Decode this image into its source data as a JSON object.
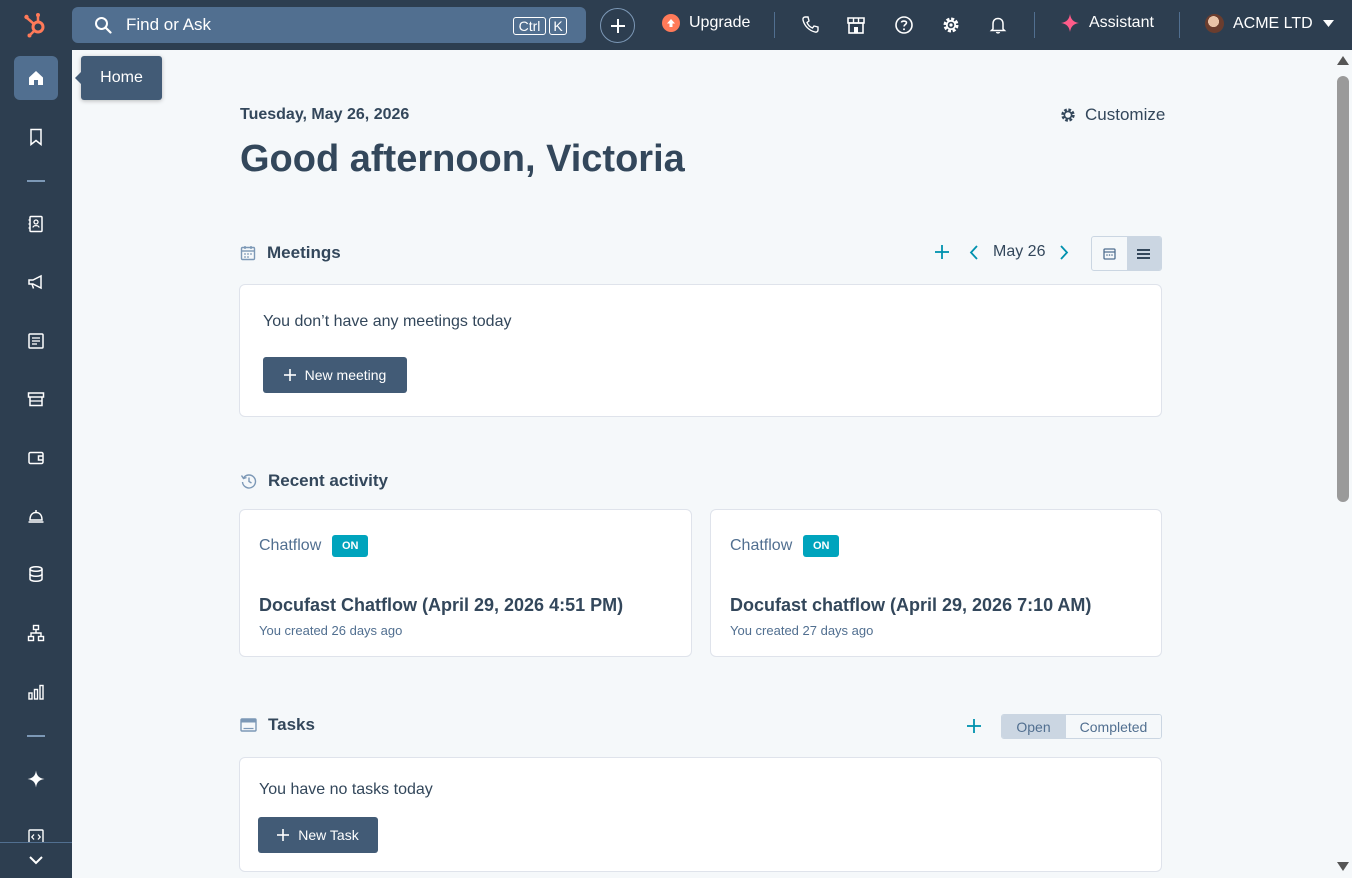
{
  "search": {
    "placeholder": "Find or Ask",
    "shortcut_ctrl": "Ctrl",
    "shortcut_key": "K"
  },
  "topbar": {
    "upgrade_label": "Upgrade",
    "assistant_label": "Assistant",
    "account_name": "ACME LTD"
  },
  "tooltip": {
    "home": "Home"
  },
  "header": {
    "date": "Tuesday, May 26, 2026",
    "greeting": "Good afternoon, Victoria",
    "customize_label": "Customize"
  },
  "meetings": {
    "title": "Meetings",
    "date_label": "May 26",
    "empty_text": "You don’t have any meetings today",
    "new_button": "New meeting"
  },
  "recent_activity": {
    "title": "Recent activity",
    "items": [
      {
        "type": "Chatflow",
        "badge": "ON",
        "title": "Docufast Chatflow (April 29, 2026 4:51 PM)",
        "subtitle": "You created 26 days ago"
      },
      {
        "type": "Chatflow",
        "badge": "ON",
        "title": "Docufast chatflow (April 29, 2026 7:10 AM)",
        "subtitle": "You created 27 days ago"
      }
    ]
  },
  "tasks": {
    "title": "Tasks",
    "tab_open": "Open",
    "tab_completed": "Completed",
    "empty_text": "You have no tasks today",
    "new_button": "New Task"
  },
  "colors": {
    "nav_bg": "#2d3e50",
    "search_bg": "#516f90",
    "accent_teal": "#00a4bd",
    "upgrade_orange": "#ff7a59",
    "button_dark": "#425b76"
  }
}
